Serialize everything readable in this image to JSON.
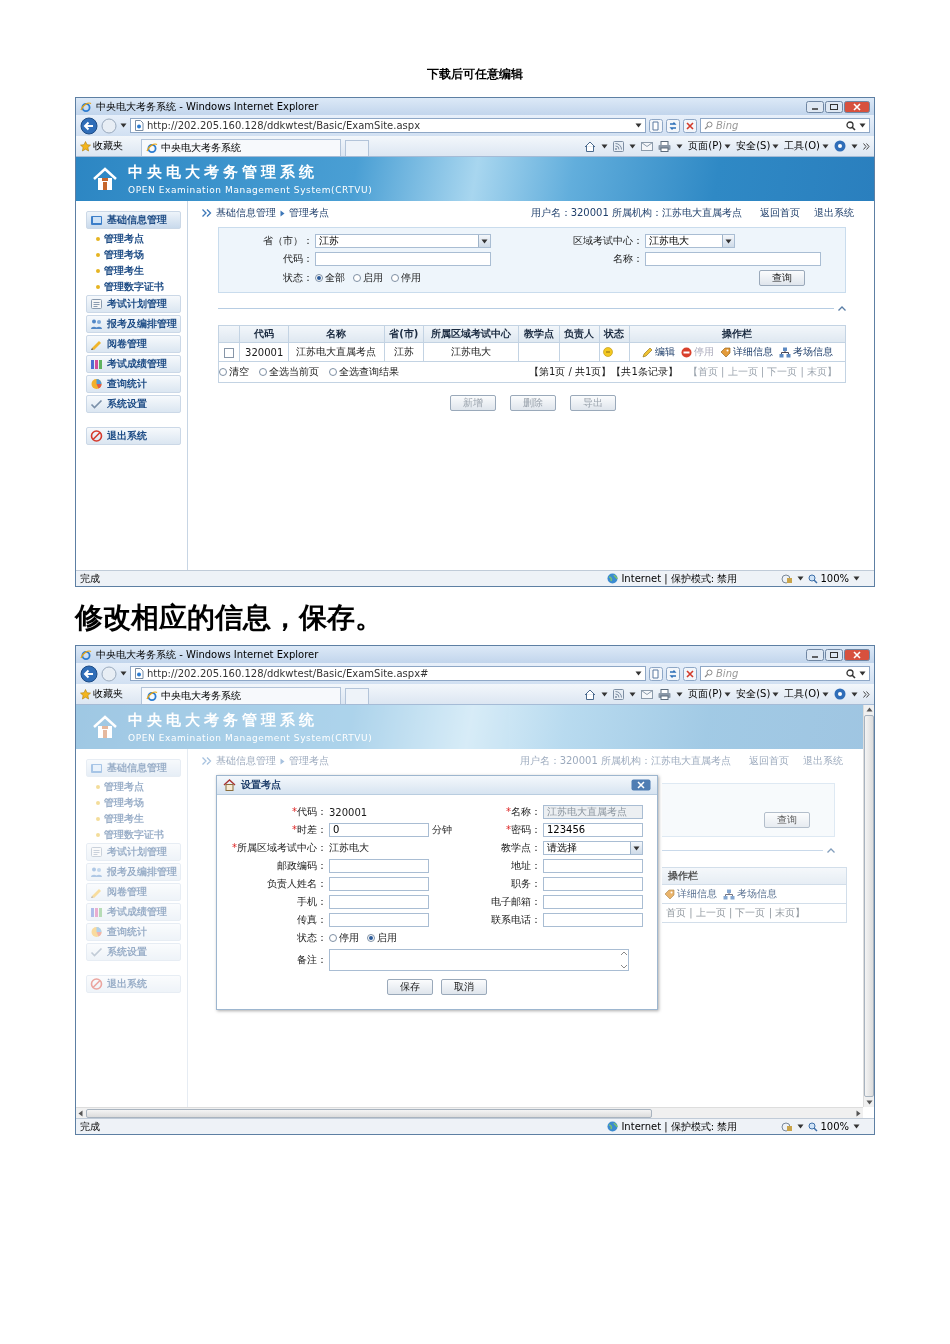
{
  "document_header": "下载后可任意编辑",
  "blocks": [
    {
      "kind": "screenshot",
      "browser": {
        "title": "中央电大考务系统 - Windows Internet Explorer",
        "address": "http://202.205.160.128/ddkwtest/Basic/ExamSite.aspx",
        "search_placeholder": "Bing",
        "favorites": "收藏夹",
        "tab": "中央电大考务系统",
        "commands": [
          "页面(P)",
          "安全(S)",
          "工具(O)"
        ],
        "status": "完成",
        "zone": "Internet | 保护模式: 禁用",
        "zoom": "100%",
        "scrollbars": false
      },
      "page": {
        "dimmed": false,
        "title": "中央电大考务管理系统",
        "subtitle": "OPEN Examination Management System(CRTVU)",
        "breadcrumb": [
          "基础信息管理",
          "管理考点"
        ],
        "user_info": "用户名：320001  所属机构：江苏电大直属考点",
        "links": [
          "返回首页",
          "退出系统"
        ],
        "sidebar": {
          "groups": [
            {
              "label": "基础信息管理",
              "expanded": true,
              "children": [
                "管理考点",
                "管理考场",
                "管理考生",
                "管理数字证书"
              ]
            },
            {
              "label": "考试计划管理",
              "expanded": false
            },
            {
              "label": "报考及编排管理",
              "expanded": false
            },
            {
              "label": "阅卷管理",
              "expanded": false
            },
            {
              "label": "考试成绩管理",
              "expanded": false
            },
            {
              "label": "查询统计",
              "expanded": false
            },
            {
              "label": "系统设置",
              "expanded": false
            }
          ],
          "exit": "退出系统"
        },
        "filter": {
          "fields": [
            {
              "kind": "select",
              "label": "省（市）：",
              "value": "江苏"
            },
            {
              "kind": "select",
              "label": "区域考试中心：",
              "value": "江苏电大"
            },
            {
              "kind": "input",
              "label": "代码："
            },
            {
              "kind": "input",
              "label": "名称："
            },
            {
              "kind": "radios",
              "label": "状态：",
              "options": [
                {
                  "label": "全部",
                  "selected": true
                },
                {
                  "label": "启用",
                  "selected": false
                },
                {
                  "label": "停用",
                  "selected": false
                }
              ]
            }
          ],
          "button": "查询"
        },
        "table": {
          "columns": [
            "代码",
            "名称",
            "省(市)",
            "所属区域考试中心",
            "教学点",
            "负责人",
            "状态",
            "操作栏"
          ],
          "rows": [
            {
              "checked": false,
              "code": "320001",
              "name": "江苏电大直属考点",
              "province": "江苏",
              "center": "江苏电大",
              "actions": [
                {
                  "label": "编辑",
                  "disabled": false
                },
                {
                  "label": "停用",
                  "disabled": true
                },
                {
                  "label": "详细信息",
                  "disabled": false
                },
                {
                  "label": "考场信息",
                  "disabled": false
                }
              ]
            }
          ],
          "selectors": [
            {
              "label": "清空",
              "selected": false
            },
            {
              "label": "全选当前页",
              "selected": false
            },
            {
              "label": "全选查询结果",
              "selected": false
            }
          ],
          "page_info": "【第1页 / 共1页】【共1条记录】",
          "nav": "【首页 | 上一页 | 下一页 | 末页】"
        },
        "buttons": [
          {
            "label": "新增",
            "disabled": true
          },
          {
            "label": "删除",
            "disabled": true
          },
          {
            "label": "导出",
            "disabled": true
          }
        ]
      }
    },
    {
      "kind": "caption",
      "text": "修改相应的信息，保存。"
    },
    {
      "kind": "screenshot",
      "browser": {
        "title": "中央电大考务系统 - Windows Internet Explorer",
        "address": "http://202.205.160.128/ddkwtest/Basic/ExamSite.aspx#",
        "search_placeholder": "Bing",
        "favorites": "收藏夹",
        "tab": "中央电大考务系统",
        "commands": [
          "页面(P)",
          "安全(S)",
          "工具(O)"
        ],
        "status": "完成",
        "zone": "Internet | 保护模式: 禁用",
        "zoom": "100%",
        "scrollbars": true
      },
      "page": {
        "dimmed": true,
        "title": "中央电大考务管理系统",
        "subtitle": "OPEN Examination Management System(CRTVU)",
        "breadcrumb": [
          "基础信息管理",
          "管理考点"
        ],
        "user_info": "用户名：320001  所属机构：江苏电大直属考点",
        "links": [
          "返回首页",
          "退出系统"
        ],
        "sidebar": {
          "groups": [
            {
              "label": "基础信息管理",
              "expanded": true,
              "children": [
                "管理考点",
                "管理考场",
                "管理考生",
                "管理数字证书"
              ]
            },
            {
              "label": "考试计划管理",
              "expanded": false
            },
            {
              "label": "报考及编排管理",
              "expanded": false
            },
            {
              "label": "阅卷管理",
              "expanded": false
            },
            {
              "label": "考试成绩管理",
              "expanded": false
            },
            {
              "label": "查询统计",
              "expanded": false
            },
            {
              "label": "系统设置",
              "expanded": false
            }
          ],
          "exit": "退出系统"
        },
        "background": {
          "search_button": "查询",
          "column": "操作栏",
          "actions": [
            "详细信息",
            "考场信息"
          ],
          "nav": "首页 | 上一页 | 下一页 | 末页】"
        },
        "dialog": {
          "title": "设置考点",
          "fields": [
            {
              "kind": "text",
              "mark": "*",
              "label": "代码：",
              "value": "320001"
            },
            {
              "kind": "input",
              "mark": "*",
              "label": "名称：",
              "value": "江苏电大直属考点",
              "disabled": true
            },
            {
              "kind": "input",
              "mark": "*",
              "label": "时差：",
              "value": "0",
              "unit": "分钟",
              "disabled": false
            },
            {
              "kind": "input",
              "mark": "*",
              "label": "密码：",
              "value": "123456",
              "disabled": false
            },
            {
              "kind": "text",
              "mark": "*",
              "label": "所属区域考试中心：",
              "value": "江苏电大"
            },
            {
              "kind": "select",
              "label": "教学点：",
              "value": "请选择"
            },
            {
              "kind": "input",
              "label": "邮政编码：",
              "disabled": false
            },
            {
              "kind": "input",
              "label": "地址：",
              "disabled": false
            },
            {
              "kind": "input",
              "label": "负责人姓名：",
              "disabled": false
            },
            {
              "kind": "input",
              "label": "职务：",
              "disabled": false
            },
            {
              "kind": "input",
              "label": "手机：",
              "disabled": false
            },
            {
              "kind": "input",
              "label": "电子邮箱：",
              "disabled": false
            },
            {
              "kind": "input",
              "label": "传真：",
              "disabled": false
            },
            {
              "kind": "input",
              "label": "联系电话：",
              "disabled": false
            },
            {
              "kind": "radios",
              "label": "状态：",
              "options": [
                {
                  "label": "停用",
                  "selected": false
                },
                {
                  "label": "启用",
                  "selected": true
                }
              ]
            },
            {
              "kind": "textarea",
              "label": "备注："
            }
          ],
          "buttons": [
            "保存",
            "取消"
          ]
        }
      }
    }
  ]
}
